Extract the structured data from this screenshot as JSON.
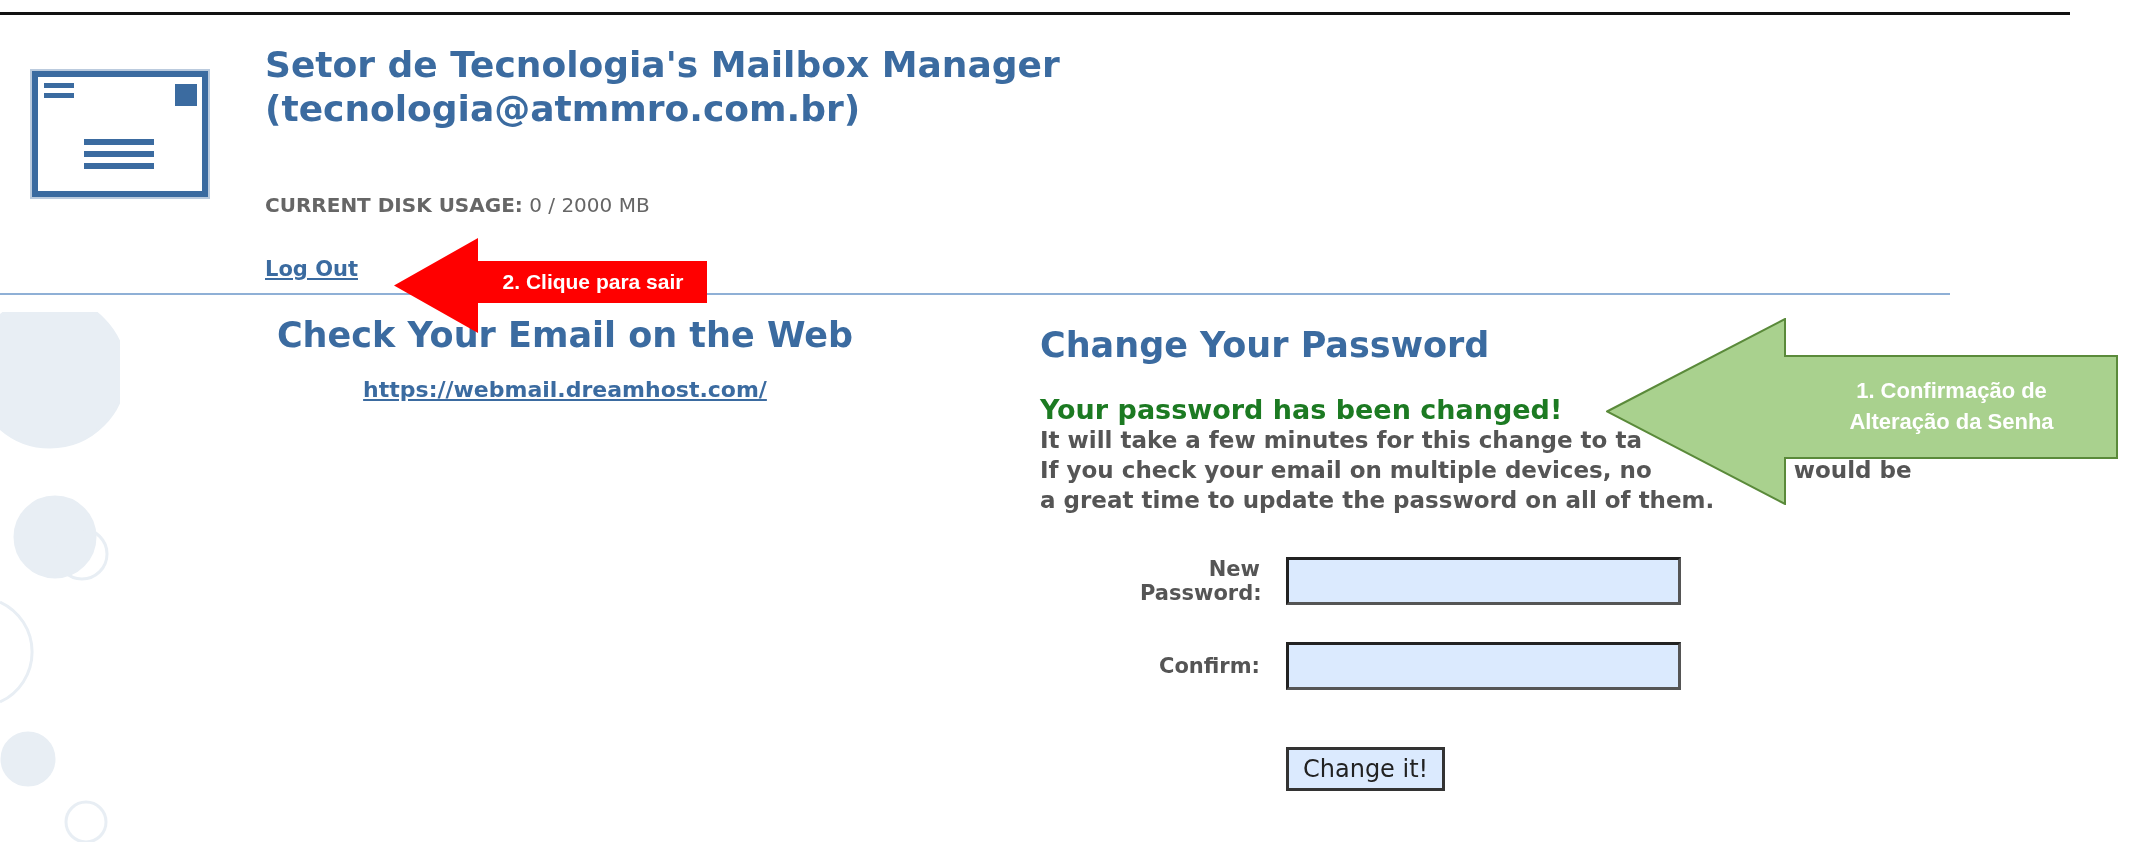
{
  "header": {
    "title": "Setor de Tecnologia's Mailbox Manager",
    "address": "(tecnologia@atmmro.com.br)",
    "disk_usage_label": "CURRENT DISK USAGE:",
    "disk_usage_value": "0 / 2000 MB",
    "logout": "Log Out"
  },
  "webmail": {
    "heading": "Check Your Email on the Web",
    "link": "https://webmail.dreamhost.com/"
  },
  "password": {
    "heading": "Change Your Password",
    "status": "Your password has been changed!",
    "lines": [
      {
        "parts": [
          "It will take a few minutes for this change to ta"
        ]
      },
      {
        "parts": [
          "If you check your email on multiple devices, no",
          "would be"
        ]
      },
      {
        "parts": [
          "a great time to update the password on all of them."
        ]
      }
    ],
    "fields": [
      {
        "label": "New Password:"
      },
      {
        "label": "Confirm:"
      }
    ],
    "button": "Change it!"
  },
  "callouts": [
    {
      "text": "2. Clique para sair",
      "color": "#ff0000"
    },
    {
      "text": "1. Confirmação de Alteração da Senha",
      "color": "#a9d18e"
    }
  ]
}
